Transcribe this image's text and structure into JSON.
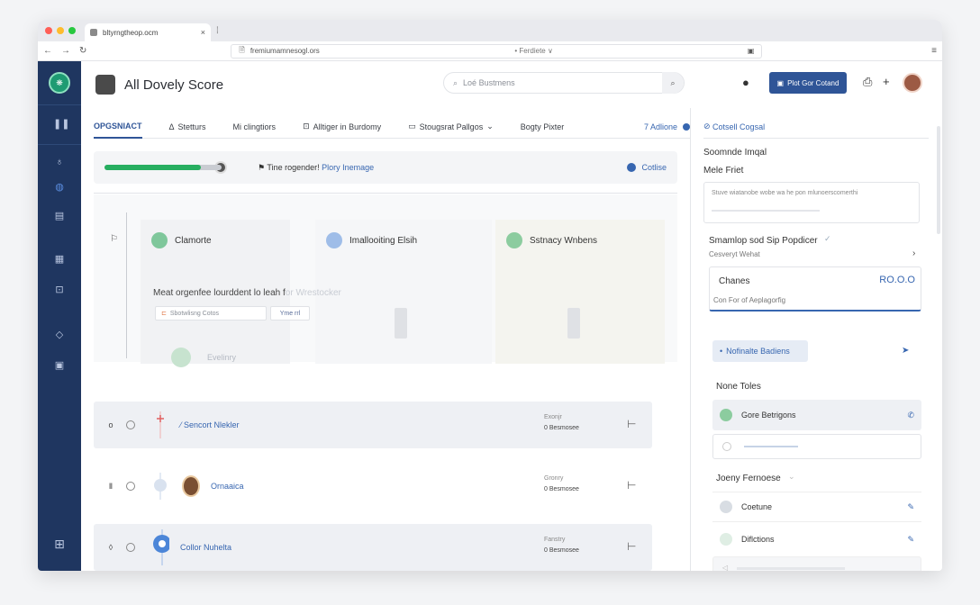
{
  "browser": {
    "tab_title": "bltyrngtheop.ocm",
    "url": "fremiumamnesogl.ors",
    "url_mid": "• Ferdiete ∨"
  },
  "header": {
    "app_title": "All Dovely Score",
    "search_placeholder": "Loé Bustmens",
    "primary_button": "Plot Gor Cotand"
  },
  "tabs": [
    {
      "label": "OPGSNIACT",
      "icon": ""
    },
    {
      "label": "Stetturs",
      "icon": "Δ"
    },
    {
      "label": "Mi clingtiors",
      "icon": ""
    },
    {
      "label": "Alltiger in Burdomy",
      "icon": "⊡"
    },
    {
      "label": "Stougsrat Pallgos",
      "icon": "▭"
    },
    {
      "label": "Bogty Pixter",
      "icon": ""
    }
  ],
  "tabs_add": "7 Adlione",
  "progress": {
    "value": 0.82,
    "text": "Tine rogender!",
    "link": "Plory Inemage",
    "action": "Cotlise"
  },
  "stage": {
    "columns": [
      "Clamorte",
      "Imallooiting Elsih",
      "Sstnacy Wnbens"
    ],
    "description": "Meat orgenfee lourddent lo leah f",
    "description_faded": "or Wrestocker",
    "field_text": "Sbotwlisng Cotos",
    "field_button": "Yme rrl",
    "ghost_label": "Evelinry"
  },
  "rows": [
    {
      "ctl": "o",
      "name": "⁄ Sencort Nlekler",
      "meta_label": "Exonjr",
      "meta_value": "0 Besmosee"
    },
    {
      "ctl": "Ⅱ",
      "name": "Ornaaica",
      "meta_label": "Gronry",
      "meta_value": "0 Besmosee"
    },
    {
      "ctl": "◊",
      "name": "Collor Nuhelta",
      "meta_label": "Fanstry",
      "meta_value": "0 Besmosee"
    }
  ],
  "panel": {
    "top_link": "Cotsell Cogsal",
    "section1_title": "Soomnde Imqal",
    "section1_sub": "Mele Friet",
    "box_text": "Stuve wiatanobe wobe wa he pon mlunoerscomerthi",
    "section2_title": "Smamlop sod Sip Popdicer",
    "section2_sub": "Cesveryt Wehat",
    "stat_label": "Chanes",
    "stat_value": "RO.O.O",
    "stat_sub": "Con For of Aeplagorfig",
    "chip": "Nofinalte Badiens",
    "section3_title": "None Toles",
    "item1": "Gore Betrigons",
    "section4_title": "Joeny Fernoese",
    "item2": "Coetune",
    "item3": "Diflctions"
  },
  "colors": {
    "rail": "#1f3660",
    "accent": "#2f5597",
    "link": "#3766b0",
    "progress": "#27ae60"
  }
}
